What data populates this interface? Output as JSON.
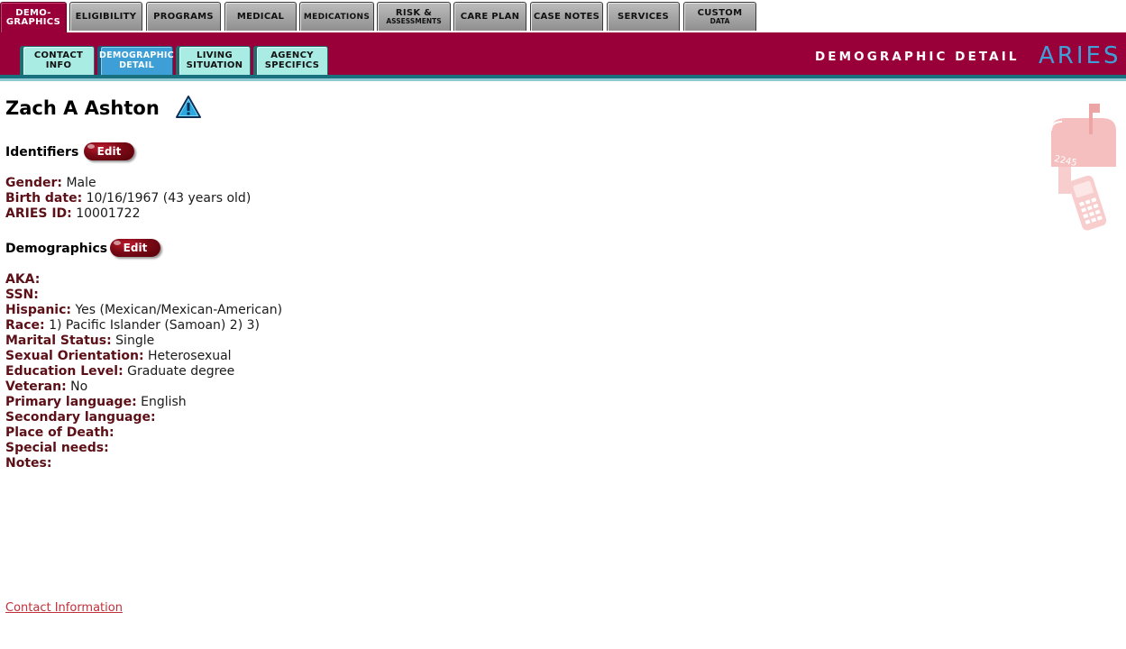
{
  "top_tabs": [
    {
      "line1": "DEMO-",
      "line2": "GRAPHICS",
      "active": true
    },
    {
      "label": "ELIGIBILITY"
    },
    {
      "label": "PROGRAMS"
    },
    {
      "label": "MEDICAL"
    },
    {
      "label": "MEDICATIONS"
    },
    {
      "line1": "RISK &",
      "line2": "ASSESSMENTS"
    },
    {
      "label": "CARE PLAN"
    },
    {
      "label": "CASE NOTES"
    },
    {
      "label": "SERVICES"
    },
    {
      "line1": "CUSTOM",
      "line2": "DATA"
    }
  ],
  "sub_tabs": [
    {
      "line1": "CONTACT",
      "line2": "INFO"
    },
    {
      "line1": "DEMOGRAPHIC",
      "line2": "DETAIL",
      "active": true
    },
    {
      "line1": "LIVING",
      "line2": "SITUATION"
    },
    {
      "line1": "AGENCY",
      "line2": "SPECIFICS"
    }
  ],
  "header": {
    "page_title": "DEMOGRAPHIC DETAIL",
    "brand": "ARIES"
  },
  "client": {
    "name": "Zach A Ashton",
    "alert_icon": "warning-triangle-icon"
  },
  "identifiers": {
    "title": "Identifiers",
    "edit_label": "Edit",
    "fields": [
      {
        "label": "Gender:",
        "value": "Male"
      },
      {
        "label": "Birth date:",
        "value": "10/16/1967 (43 years old)"
      },
      {
        "label": "ARIES ID:",
        "value": "10001722"
      }
    ]
  },
  "demographics": {
    "title": "Demographics",
    "edit_label": "Edit",
    "fields": [
      {
        "label": "AKA:",
        "value": ""
      },
      {
        "label": "SSN:",
        "value": ""
      },
      {
        "label": "Hispanic:",
        "value": "Yes (Mexican/Mexican-American)"
      },
      {
        "label": "Race:",
        "value": "1) Pacific Islander (Samoan) 2) 3)"
      },
      {
        "label": "Marital Status:",
        "value": "Single"
      },
      {
        "label": "Sexual Orientation:",
        "value": "Heterosexual"
      },
      {
        "label": "Education Level:",
        "value": "Graduate degree"
      },
      {
        "label": "Veteran:",
        "value": "No"
      },
      {
        "label": "Primary language:",
        "value": "English"
      },
      {
        "label": "Secondary language:",
        "value": ""
      },
      {
        "label": "Place of Death:",
        "value": ""
      },
      {
        "label": "Special needs:",
        "value": ""
      },
      {
        "label": "Notes:",
        "value": ""
      }
    ]
  },
  "footer": {
    "contact_link": "Contact Information"
  },
  "decor": {
    "mailbox_icon": "mailbox-phone-icon",
    "mailbox_number": "2245"
  },
  "colors": {
    "brand_maroon": "#99003a",
    "teal_line": "#18707e",
    "label_color": "#5c0f16",
    "brand_blue": "#3fa0d8"
  }
}
